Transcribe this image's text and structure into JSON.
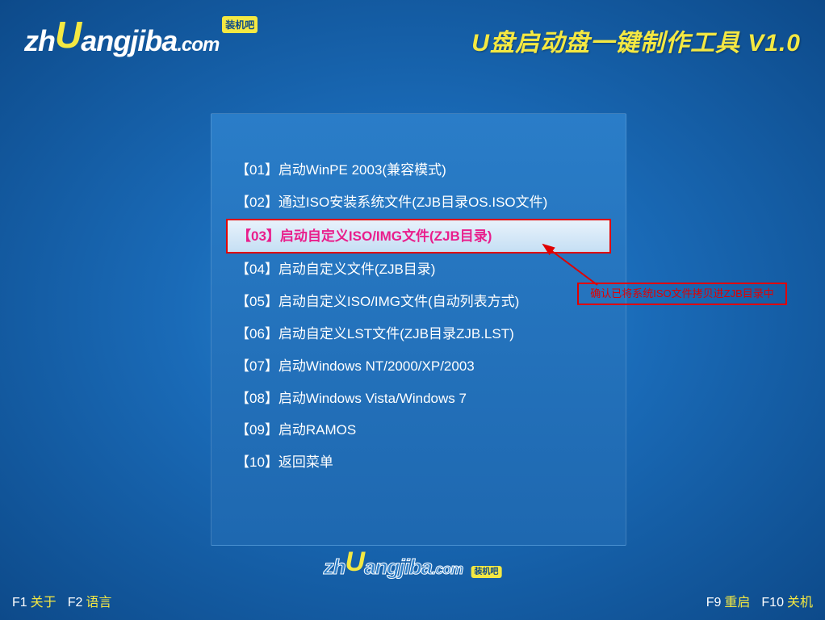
{
  "header": {
    "logo_zh": "zh",
    "logo_u": "U",
    "logo_rest": "angjiba",
    "logo_com": ".com",
    "logo_cn": "装机吧",
    "title": "U盘启动盘一键制作工具 V1.0"
  },
  "menu": {
    "items": [
      {
        "label": "【01】启动WinPE 2003(兼容模式)",
        "selected": false
      },
      {
        "label": "【02】通过ISO安装系统文件(ZJB目录OS.ISO文件)",
        "selected": false
      },
      {
        "label": "【03】启动自定义ISO/IMG文件(ZJB目录)",
        "selected": true
      },
      {
        "label": "【04】启动自定义文件(ZJB目录)",
        "selected": false
      },
      {
        "label": "【05】启动自定义ISO/IMG文件(自动列表方式)",
        "selected": false
      },
      {
        "label": "【06】启动自定义LST文件(ZJB目录ZJB.LST)",
        "selected": false
      },
      {
        "label": "【07】启动Windows NT/2000/XP/2003",
        "selected": false
      },
      {
        "label": "【08】启动Windows Vista/Windows 7",
        "selected": false
      },
      {
        "label": "【09】启动RAMOS",
        "selected": false
      },
      {
        "label": "【10】返回菜单",
        "selected": false
      }
    ]
  },
  "annotation": {
    "text": "确认已将系统ISO文件拷贝进ZJB目录中"
  },
  "footer": {
    "left": [
      {
        "key": "F1",
        "label": "关于"
      },
      {
        "key": "F2",
        "label": "语言"
      }
    ],
    "right": [
      {
        "key": "F9",
        "label": "重启"
      },
      {
        "key": "F10",
        "label": "关机"
      }
    ]
  }
}
